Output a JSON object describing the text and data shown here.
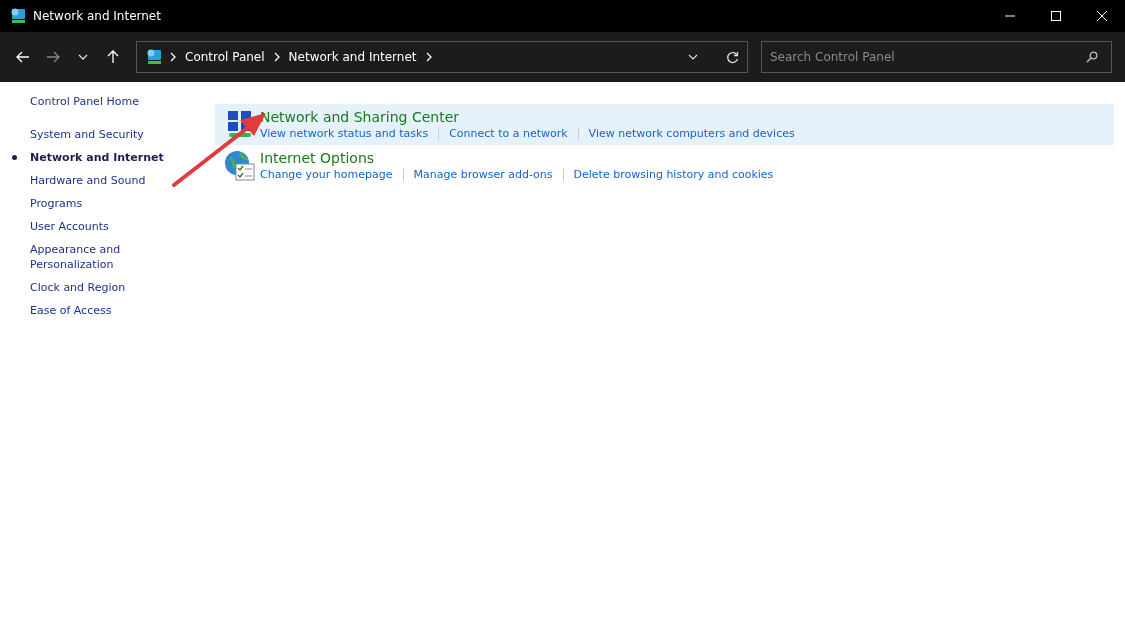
{
  "window": {
    "title": "Network and Internet"
  },
  "address_bar": {
    "breadcrumbs": [
      "Control Panel",
      "Network and Internet"
    ]
  },
  "search": {
    "placeholder": "Search Control Panel"
  },
  "sidebar": {
    "home": "Control Panel Home",
    "items": [
      {
        "label": "System and Security",
        "selected": false
      },
      {
        "label": "Network and Internet",
        "selected": true
      },
      {
        "label": "Hardware and Sound",
        "selected": false
      },
      {
        "label": "Programs",
        "selected": false
      },
      {
        "label": "User Accounts",
        "selected": false
      },
      {
        "label": "Appearance and Personalization",
        "selected": false
      },
      {
        "label": "Clock and Region",
        "selected": false
      },
      {
        "label": "Ease of Access",
        "selected": false
      }
    ]
  },
  "categories": [
    {
      "kind": "network",
      "title": "Network and Sharing Center",
      "highlighted": true,
      "links": [
        "View network status and tasks",
        "Connect to a network",
        "View network computers and devices"
      ]
    },
    {
      "kind": "internet",
      "title": "Internet Options",
      "highlighted": false,
      "links": [
        "Change your homepage",
        "Manage browser add-ons",
        "Delete browsing history and cookies"
      ]
    }
  ]
}
